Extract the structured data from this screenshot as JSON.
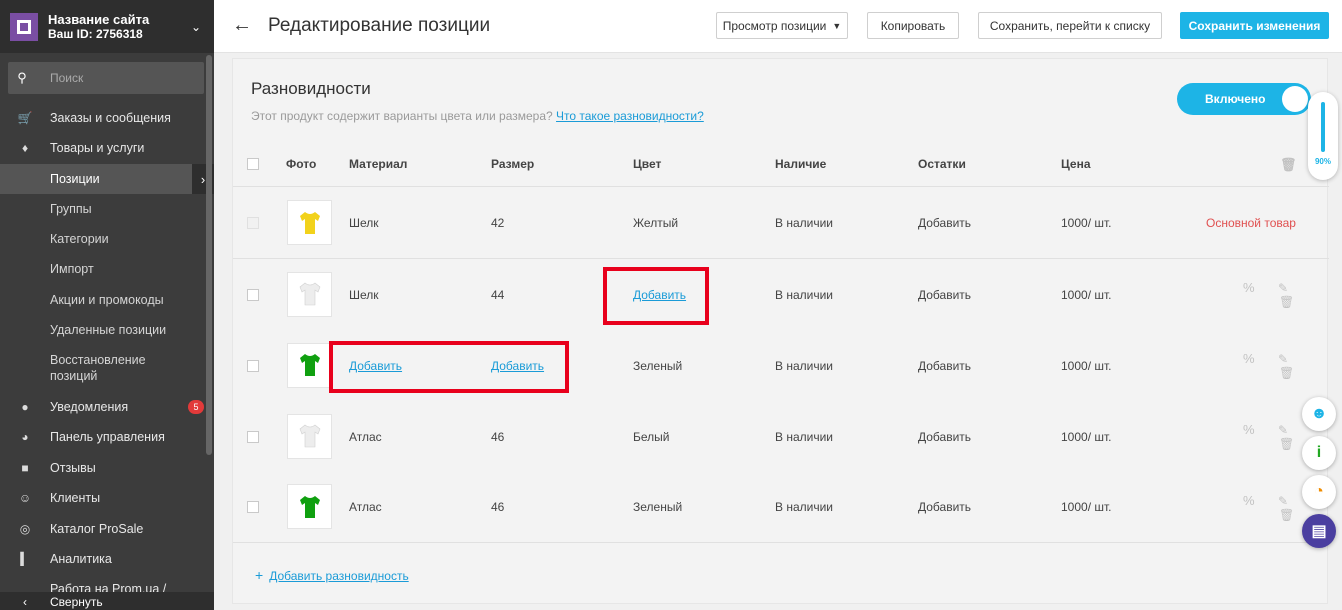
{
  "sidebar": {
    "site_name": "Название сайта",
    "site_id": "Ваш ID: 2756318",
    "search_placeholder": "Поиск",
    "items": [
      {
        "label": "Заказы и сообщения",
        "icon": "cart-icon"
      },
      {
        "label": "Товары и услуги",
        "icon": "tag-icon"
      },
      {
        "label": "Позиции",
        "icon": ""
      },
      {
        "label": "Группы",
        "icon": ""
      },
      {
        "label": "Категории",
        "icon": ""
      },
      {
        "label": "Импорт",
        "icon": ""
      },
      {
        "label": "Акции и промокоды",
        "icon": ""
      },
      {
        "label": "Удаленные позиции",
        "icon": ""
      },
      {
        "label": "Восстановление позиций",
        "icon": ""
      },
      {
        "label": "Уведомления",
        "icon": "bell-icon",
        "badge": "5"
      },
      {
        "label": "Панель управления",
        "icon": "dashboard-icon"
      },
      {
        "label": "Отзывы",
        "icon": "comment-icon"
      },
      {
        "label": "Клиенты",
        "icon": "users-icon"
      },
      {
        "label": "Каталог ProSale",
        "icon": "target-icon"
      },
      {
        "label": "Аналитика",
        "icon": "chart-icon"
      },
      {
        "label": "Работа на Prom.ua /",
        "icon": ""
      }
    ],
    "collapse_label": "Свернуть"
  },
  "topbar": {
    "title": "Редактирование позиции",
    "view_select": "Просмотр позиции",
    "copy": "Копировать",
    "save_list": "Сохранить, перейти к списку",
    "save": "Сохранить изменения"
  },
  "variants": {
    "title": "Разновидности",
    "subtitle": "Этот продукт содержит варианты цвета или размера?",
    "subtitle_link": "Что такое разновидности?",
    "toggle": "Включено",
    "columns": [
      "Фото",
      "Материал",
      "Размер",
      "Цвет",
      "Наличие",
      "Остатки",
      "Цена"
    ],
    "rows": [
      {
        "material": "Шелк",
        "size": "42",
        "color": "Желтый",
        "availability": "В наличии",
        "stock": "Добавить",
        "price": "1000/ шт.",
        "extra": "Основной товар",
        "shirt_color": "#f2d21b"
      },
      {
        "material": "Шелк",
        "size": "44",
        "color": "Добавить",
        "availability": "В наличии",
        "stock": "Добавить",
        "price": "1000/ шт.",
        "extra": "",
        "shirt_color": "#ededed"
      },
      {
        "material": "Добавить",
        "size": "Добавить",
        "color": "Зеленый",
        "availability": "В наличии",
        "stock": "Добавить",
        "price": "1000/ шт.",
        "extra": "",
        "shirt_color": "#10a010"
      },
      {
        "material": "Атлас",
        "size": "46",
        "color": "Белый",
        "availability": "В наличии",
        "stock": "Добавить",
        "price": "1000/ шт.",
        "extra": "",
        "shirt_color": "#ededed"
      },
      {
        "material": "Атлас",
        "size": "46",
        "color": "Зеленый",
        "availability": "В наличии",
        "stock": "Добавить",
        "price": "1000/ шт.",
        "extra": "",
        "shirt_color": "#10a010"
      }
    ],
    "add_variant": "Добавить разновидность"
  },
  "zoom": "90%"
}
